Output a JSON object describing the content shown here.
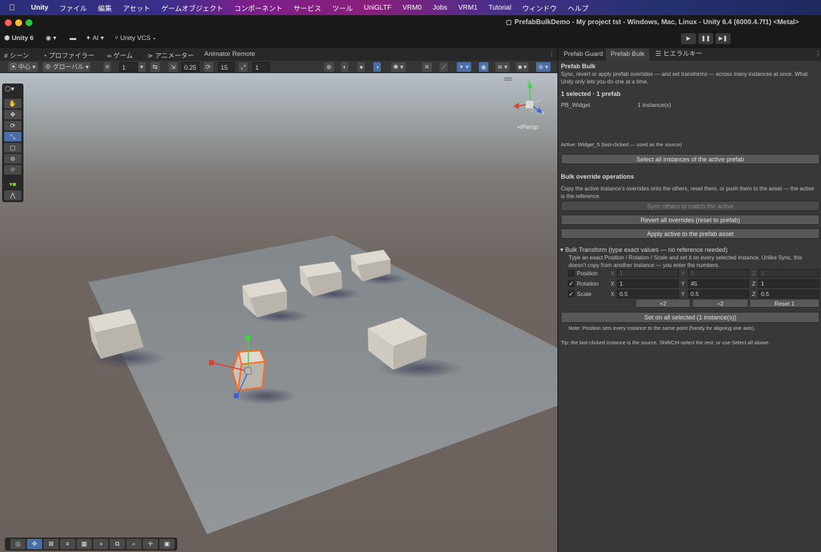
{
  "menubar": {
    "apple": "",
    "items": [
      "Unity",
      "ファイル",
      "編集",
      "アセット",
      "ゲームオブジェクト",
      "コンポーネント",
      "サービス",
      "ツール",
      "UniGLTF",
      "VRM0",
      "Jobs",
      "VRM1",
      "Tutorial",
      "ウィンドウ",
      "ヘルプ"
    ]
  },
  "window": {
    "title": "PrefabBulkDemo - My project tst - Windows, Mac, Linux - Unity 6.4 (6000.4.7f1) <Metal>"
  },
  "toolbar": {
    "unity_label": "Unity 6",
    "ai_label": "AI",
    "vcs_label": "Unity VCS",
    "play": "▶",
    "pause": "❚❚",
    "step": "▶❚"
  },
  "scene_tabs": [
    "シーン",
    "プロファイラー",
    "ゲーム",
    "アニメーター",
    "Animator Remote"
  ],
  "scene_toolbar": {
    "pivot": "中心",
    "space": "グローバル",
    "grid_value": "1",
    "snap_value": "0.25",
    "rot_value": "15",
    "scale_value": "1"
  },
  "scene": {
    "persp_label": "Persp"
  },
  "right_tabs": [
    "Prefab Guard",
    "Prefab Bulk",
    "ヒエラルキー"
  ],
  "panel": {
    "title": "Prefab Bulk",
    "intro": "Sync, revert or apply prefab overrides — and set transforms — across many instances at once. What Unity only lets you do one at a time.",
    "selection_summary": "1 selected · 1 prefab",
    "prefab_name": "PB_Widget",
    "prefab_count": "1 instance(s)",
    "active_info": "Active: Widget_5   (last-clicked — used as the source)",
    "select_all_button": "Select all instances of the active prefab",
    "bulk_override_heading": "Bulk override operations",
    "bulk_override_desc": "Copy the active instance's overrides onto the others, reset them, or push them to the asset — the active is the reference.",
    "sync_button": "Sync others to match the active",
    "revert_button": "Revert all overrides  (reset to prefab)",
    "apply_button": "Apply active to the prefab asset",
    "bulk_transform_heading": "Bulk Transform  (type exact values — no reference needed)",
    "bulk_transform_desc": "Type an exact Position / Rotation / Scale and set it on every selected instance. Unlike Sync, this doesn't copy from another instance — you enter the numbers.",
    "rows": [
      {
        "label": "Position",
        "checked": "",
        "x": "1",
        "y": "1",
        "z": "1"
      },
      {
        "label": "Rotation",
        "checked": "✓",
        "x": "1",
        "y": "45",
        "z": "1"
      },
      {
        "label": "Scale",
        "checked": "✓",
        "x": "0.5",
        "y": "0.5",
        "z": "0.5"
      }
    ],
    "axis_x": "X",
    "axis_y": "Y",
    "axis_z": "Z",
    "times2": "×2",
    "div2": "÷2",
    "reset1": "Reset 1",
    "set_button": "Set on all selected  (1 instance(s))",
    "note": "Note: Position sets every instance to the same point (handy for aligning one axis).",
    "tip": "Tip: the last-clicked instance is the source. Shift/Ctrl-select the rest, or use Select all above."
  },
  "colors": {
    "accent": "#4a6ea8",
    "selection": "#ff6a1a",
    "panel_bg": "#383838"
  }
}
